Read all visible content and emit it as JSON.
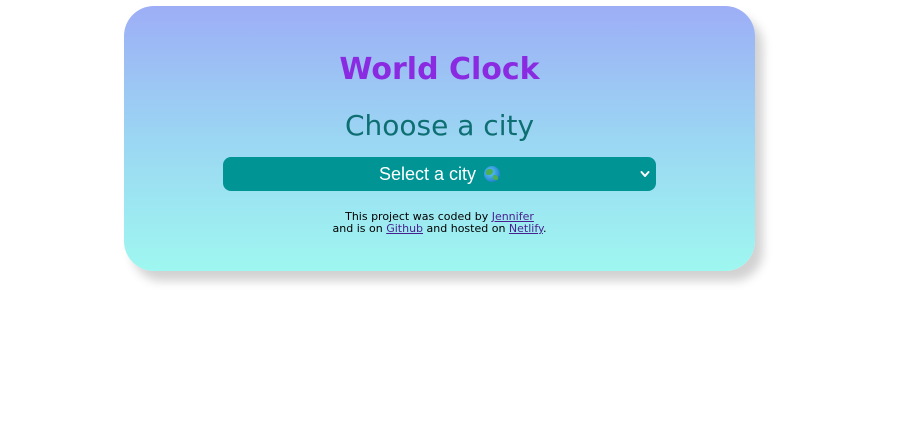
{
  "app": {
    "title": "World Clock",
    "subtitle": "Choose a city"
  },
  "select": {
    "selected_label": "Select a city",
    "icon": "globe-icon",
    "background_color": "#009494"
  },
  "footer": {
    "line1_prefix": "This project was coded by ",
    "author_link": "Jennifer",
    "line2_prefix": "and is on ",
    "github_link": "Github",
    "line2_middle": " and hosted on ",
    "netlify_link": "Netlify",
    "line2_suffix": "."
  },
  "colors": {
    "title": "#8a2be2",
    "subtitle": "#0e6f73",
    "gradient_top": "#9daef6",
    "gradient_bottom": "#9ef7f0"
  }
}
